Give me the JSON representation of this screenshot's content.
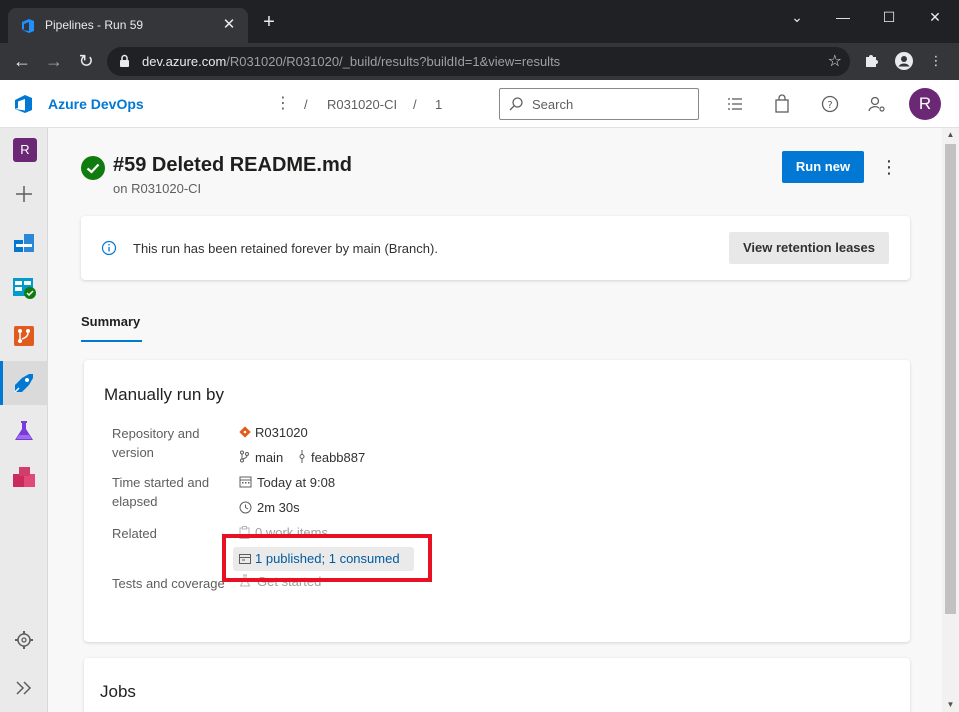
{
  "browser": {
    "tab_title": "Pipelines - Run 59",
    "url_host": "dev.azure.com",
    "url_path": "/R031020/R031020/_build/results?buildId=1&view=results"
  },
  "header": {
    "brand": "Azure DevOps",
    "breadcrumb_sep": "/",
    "breadcrumb_pipeline": "R031020-CI",
    "breadcrumb_run": "1",
    "search_placeholder": "Search",
    "avatar_initial": "R"
  },
  "rail": {
    "project_initial": "R"
  },
  "run": {
    "title": "#59 Deleted README.md",
    "subtitle": "on R031020-CI",
    "run_new_label": "Run new",
    "more_label": "⋮"
  },
  "banner": {
    "text": "This run has been retained forever by main (Branch).",
    "button_label": "View retention leases"
  },
  "tabs": {
    "summary": "Summary"
  },
  "summary_card": {
    "title": "Manually run by",
    "repo_label": "Repository and version",
    "repo_name": "R031020",
    "branch": "main",
    "commit": "feabb887",
    "time_label": "Time started and elapsed",
    "started": "Today at 9:08",
    "elapsed": "2m 30s",
    "related_label": "Related",
    "work_items": "0 work items",
    "artifacts": "1 published; 1 consumed",
    "tests_label": "Tests and coverage",
    "tests_value": "Get started"
  },
  "jobs": {
    "title": "Jobs"
  },
  "colors": {
    "accent": "#0078d4",
    "success": "#107c10",
    "highlight": "#e81123",
    "avatar": "#6b2874"
  }
}
